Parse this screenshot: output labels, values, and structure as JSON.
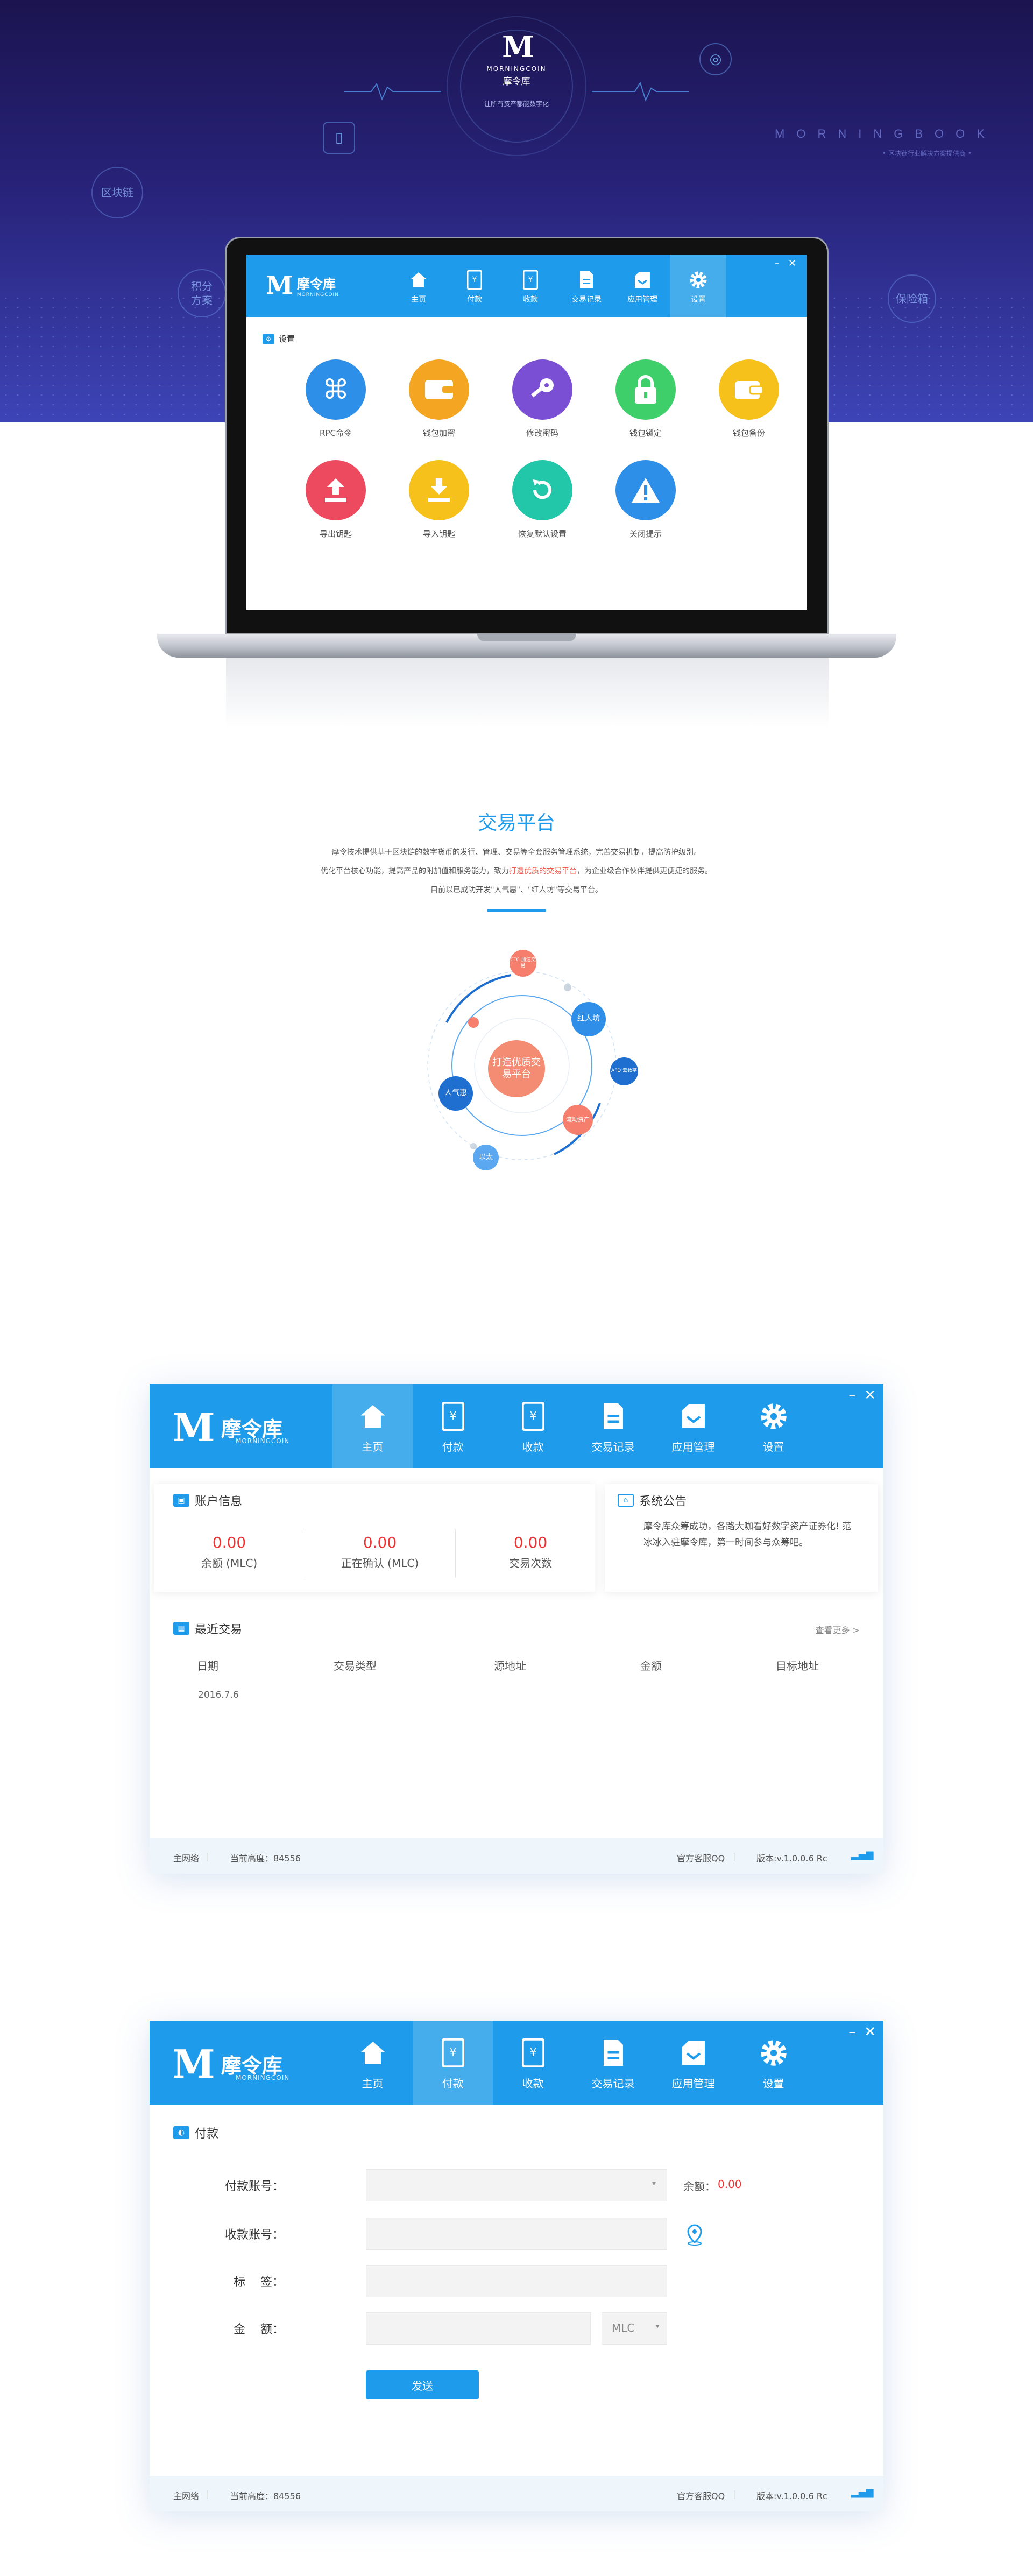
{
  "hero": {
    "brand_mark": "M",
    "brand_en": "MORNINGCOIN",
    "brand_cn": "摩令库",
    "slogan": "让所有资产都能数字化",
    "morningbook": "MORNINGBOOK",
    "morningbook_sub": "• 区块链行业解决方案提供商 •",
    "bubble_blockchain": "区块链",
    "bubble_points": "积分方案",
    "bubble_cloud": "保险箱"
  },
  "app": {
    "logo_mark": "M",
    "logo_cn": "摩令库",
    "logo_en": "MORNINGCOIN",
    "minimize": "–",
    "close": "✕",
    "nav": [
      {
        "label": "主页",
        "icon": "home-icon"
      },
      {
        "label": "付款",
        "icon": "pay-icon"
      },
      {
        "label": "收款",
        "icon": "receive-icon"
      },
      {
        "label": "交易记录",
        "icon": "records-icon"
      },
      {
        "label": "应用管理",
        "icon": "apps-icon"
      },
      {
        "label": "设置",
        "icon": "gear-icon"
      }
    ]
  },
  "settings": {
    "title": "设置",
    "items": [
      {
        "label": "RPC命令",
        "color": "#2d8fe8"
      },
      {
        "label": "钱包加密",
        "color": "#f4a623"
      },
      {
        "label": "修改密码",
        "color": "#7b4fd4"
      },
      {
        "label": "钱包锁定",
        "color": "#3ecf6a"
      },
      {
        "label": "钱包备份",
        "color": "#f6c11a"
      },
      {
        "label": "导出钥匙",
        "color": "#ee4a5f"
      },
      {
        "label": "导入钥匙",
        "color": "#f6c11a"
      },
      {
        "label": "恢复默认设置",
        "color": "#22c6a8"
      },
      {
        "label": "关闭提示",
        "color": "#2d8fe8"
      }
    ]
  },
  "trade": {
    "title": "交易平台",
    "desc1": "摩令技术提供基于区块链的数字货币的发行、管理、交易等全套服务管理系统，完善交易机制，提高防护级别。",
    "desc2_a": "优化平台核心功能，提高产品的附加值和服务能力，致力",
    "desc2_hl": "打造优质的交易平台",
    "desc2_b": "，为企业级合作伙伴提供更便捷的服务。",
    "desc3": "目前以已成功开发\"人气惠\"、\"红人坊\"等交易平台。",
    "center": "打造优质交易平台",
    "orbs": [
      "CTC 加速交易",
      "红人坊",
      "AFD 云数字",
      "人气惠",
      "流动资产",
      "以太"
    ]
  },
  "home_window": {
    "account_title": "账户信息",
    "notice_title": "系统公告",
    "notice_text": "摩令库众筹成功，各路大咖看好数字资产证券化! 范冰冰入驻摩令库，第一时间参与众筹吧。",
    "stats": [
      {
        "value": "0.00",
        "label": "余额 (MLC)"
      },
      {
        "value": "0.00",
        "label": "正在确认 (MLC)"
      },
      {
        "value": "0.00",
        "label": "交易次数"
      }
    ],
    "recent_title": "最近交易",
    "view_more": "查看更多 >",
    "columns": [
      "日期",
      "交易类型",
      "源地址",
      "金额",
      "目标地址"
    ],
    "rows": [
      [
        "2016.7.6",
        "",
        "",
        "",
        ""
      ]
    ]
  },
  "status": {
    "network": "主网络",
    "height_label": "当前高度：84556",
    "qq": "官方客服QQ",
    "version": "版本:v.1.0.0.6 Rc"
  },
  "pay_window": {
    "title": "付款",
    "pay_account": "付款账号：",
    "balance_label": "余额：",
    "balance_value": "0.00",
    "recv_account": "收款账号：",
    "tag": "标    签：",
    "amount": "金    额：",
    "unit": "MLC",
    "send": "发送"
  }
}
